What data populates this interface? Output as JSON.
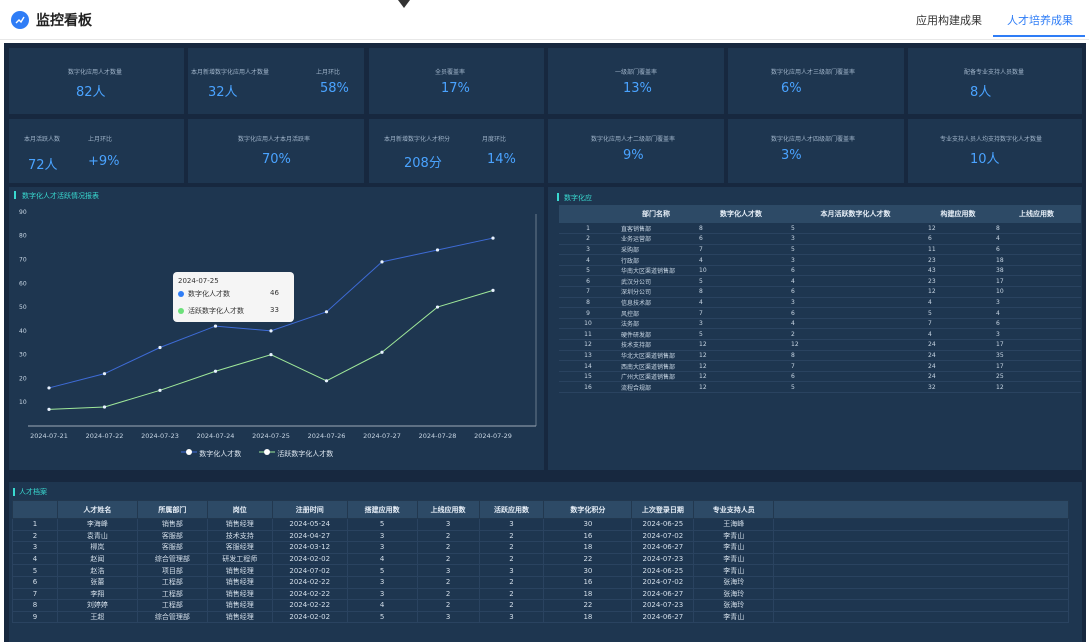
{
  "header": {
    "title": "监控看板",
    "tabs": [
      {
        "label": "应用构建成果",
        "active": false
      },
      {
        "label": "人才培养成果",
        "active": true
      }
    ]
  },
  "colors": {
    "accent": "#2f7df6",
    "kpi_value": "#4aa3ff",
    "panel_title": "#39d9d0",
    "series_blue": "#3e6bd6",
    "series_green": "#9fe89a"
  },
  "kpis_row1": [
    {
      "label": "数字化应用人才数量",
      "value": "82人"
    },
    {
      "label": "本月新增数字化应用人才数量",
      "value": "32人",
      "label2": "上月环比",
      "value2": "58%"
    },
    {
      "label": "全员覆盖率",
      "value": "17%"
    },
    {
      "label": "一级部门覆盖率",
      "value": "13%"
    },
    {
      "label": "数字化应用人才三级部门覆盖率",
      "value": "6%"
    },
    {
      "label": "配备专业支持人员数量",
      "value": "8人"
    }
  ],
  "kpis_row2": [
    {
      "label": "本月活跃人数",
      "value": "72人",
      "label2": "上月环比",
      "value2": "+9%"
    },
    {
      "label": "数字化应用人才本月活跃率",
      "value": "70%"
    },
    {
      "label": "本月新增数字化人才积分",
      "value": "208分",
      "label2": "月度环比",
      "value2": "14%"
    },
    {
      "label": "数字化应用人才二级部门覆盖率",
      "value": "9%"
    },
    {
      "label": "数字化应用人才四级部门覆盖率",
      "value": "3%"
    },
    {
      "label": "专业支持人员人均支持数字化人才数量",
      "value": "10人"
    }
  ],
  "chart_panel": {
    "title": "数字化人才活跃情况报表"
  },
  "chart_data": {
    "type": "line",
    "title": "",
    "categories": [
      "2024-07-21",
      "2024-07-22",
      "2024-07-23",
      "2024-07-24",
      "2024-07-25",
      "2024-07-26",
      "2024-07-27",
      "2024-07-28",
      "2024-07-29"
    ],
    "y_ticks": [
      10,
      20,
      30,
      40,
      50,
      60,
      70,
      80,
      90
    ],
    "ylim": [
      0,
      95
    ],
    "series": [
      {
        "name": "数字化人才数",
        "values": [
          16,
          22,
          33,
          42,
          40,
          48,
          69,
          74,
          79
        ]
      },
      {
        "name": "活跃数字化人才数",
        "values": [
          7,
          8,
          15,
          23,
          30,
          19,
          31,
          50,
          57
        ]
      }
    ],
    "grid": false,
    "legend": "bottom-center",
    "tooltip": {
      "date": "2024-07-25",
      "rows": [
        {
          "label": "数字化人才数",
          "value": "46"
        },
        {
          "label": "活跃数字化人才数",
          "value": "33"
        }
      ]
    }
  },
  "right_panel": {
    "title": "数字化应",
    "columns": [
      "",
      "部门名称",
      "数字化人才数",
      "本月活跃数字化人才数",
      "构建应用数",
      "上线应用数"
    ],
    "rows": [
      [
        "1",
        "直客销售部",
        "8",
        "5",
        "12",
        "8"
      ],
      [
        "2",
        "业务运营部",
        "6",
        "3",
        "6",
        "4"
      ],
      [
        "3",
        "采购部",
        "7",
        "5",
        "11",
        "6"
      ],
      [
        "4",
        "行政部",
        "4",
        "3",
        "23",
        "18"
      ],
      [
        "5",
        "华南大区渠道销售部",
        "10",
        "6",
        "43",
        "38"
      ],
      [
        "6",
        "武汉分公司",
        "5",
        "4",
        "23",
        "17"
      ],
      [
        "7",
        "深圳分公司",
        "8",
        "6",
        "12",
        "10"
      ],
      [
        "8",
        "信息技术部",
        "4",
        "3",
        "4",
        "3"
      ],
      [
        "9",
        "风控部",
        "7",
        "6",
        "5",
        "4"
      ],
      [
        "10",
        "法务部",
        "3",
        "4",
        "7",
        "6"
      ],
      [
        "11",
        "硬件研发部",
        "5",
        "2",
        "4",
        "3"
      ],
      [
        "12",
        "技术支持部",
        "12",
        "12",
        "24",
        "17"
      ],
      [
        "13",
        "华北大区渠道销售部",
        "12",
        "8",
        "24",
        "35"
      ],
      [
        "14",
        "西南大区渠道销售部",
        "12",
        "7",
        "24",
        "17"
      ],
      [
        "15",
        "广州大区渠道销售部",
        "12",
        "6",
        "24",
        "25"
      ],
      [
        "16",
        "流程合规部",
        "12",
        "5",
        "32",
        "12"
      ]
    ]
  },
  "talent_panel": {
    "title": "人才档案",
    "columns": [
      "",
      "人才姓名",
      "所属部门",
      "岗位",
      "注册时间",
      "搭建应用数",
      "上线应用数",
      "活跃应用数",
      "数字化积分",
      "上次登录日期",
      "专业支持人员"
    ],
    "rows": [
      [
        "1",
        "李海峰",
        "销售部",
        "销售经理",
        "2024-05-24",
        "5",
        "3",
        "3",
        "30",
        "2024-06-25",
        "王海峰"
      ],
      [
        "2",
        "袁青山",
        "客服部",
        "技术支持",
        "2024-04-27",
        "3",
        "2",
        "2",
        "16",
        "2024-07-02",
        "李青山"
      ],
      [
        "3",
        "柳岚",
        "客服部",
        "客服经理",
        "2024-03-12",
        "3",
        "2",
        "2",
        "18",
        "2024-06-27",
        "李青山"
      ],
      [
        "4",
        "赵闻",
        "综合管理部",
        "研发工程师",
        "2024-02-02",
        "4",
        "2",
        "2",
        "22",
        "2024-07-23",
        "李青山"
      ],
      [
        "5",
        "赵浩",
        "项目部",
        "销售经理",
        "2024-07-02",
        "5",
        "3",
        "3",
        "30",
        "2024-06-25",
        "李青山"
      ],
      [
        "6",
        "张蕾",
        "工程部",
        "销售经理",
        "2024-02-22",
        "3",
        "2",
        "2",
        "16",
        "2024-07-02",
        "张海玲"
      ],
      [
        "7",
        "李翔",
        "工程部",
        "销售经理",
        "2024-02-22",
        "3",
        "2",
        "2",
        "18",
        "2024-06-27",
        "张海玲"
      ],
      [
        "8",
        "刘婷婷",
        "工程部",
        "销售经理",
        "2024-02-22",
        "4",
        "2",
        "2",
        "22",
        "2024-07-23",
        "张海玲"
      ],
      [
        "9",
        "王超",
        "综合管理部",
        "销售经理",
        "2024-02-02",
        "5",
        "3",
        "3",
        "18",
        "2024-06-27",
        "李青山"
      ]
    ]
  }
}
